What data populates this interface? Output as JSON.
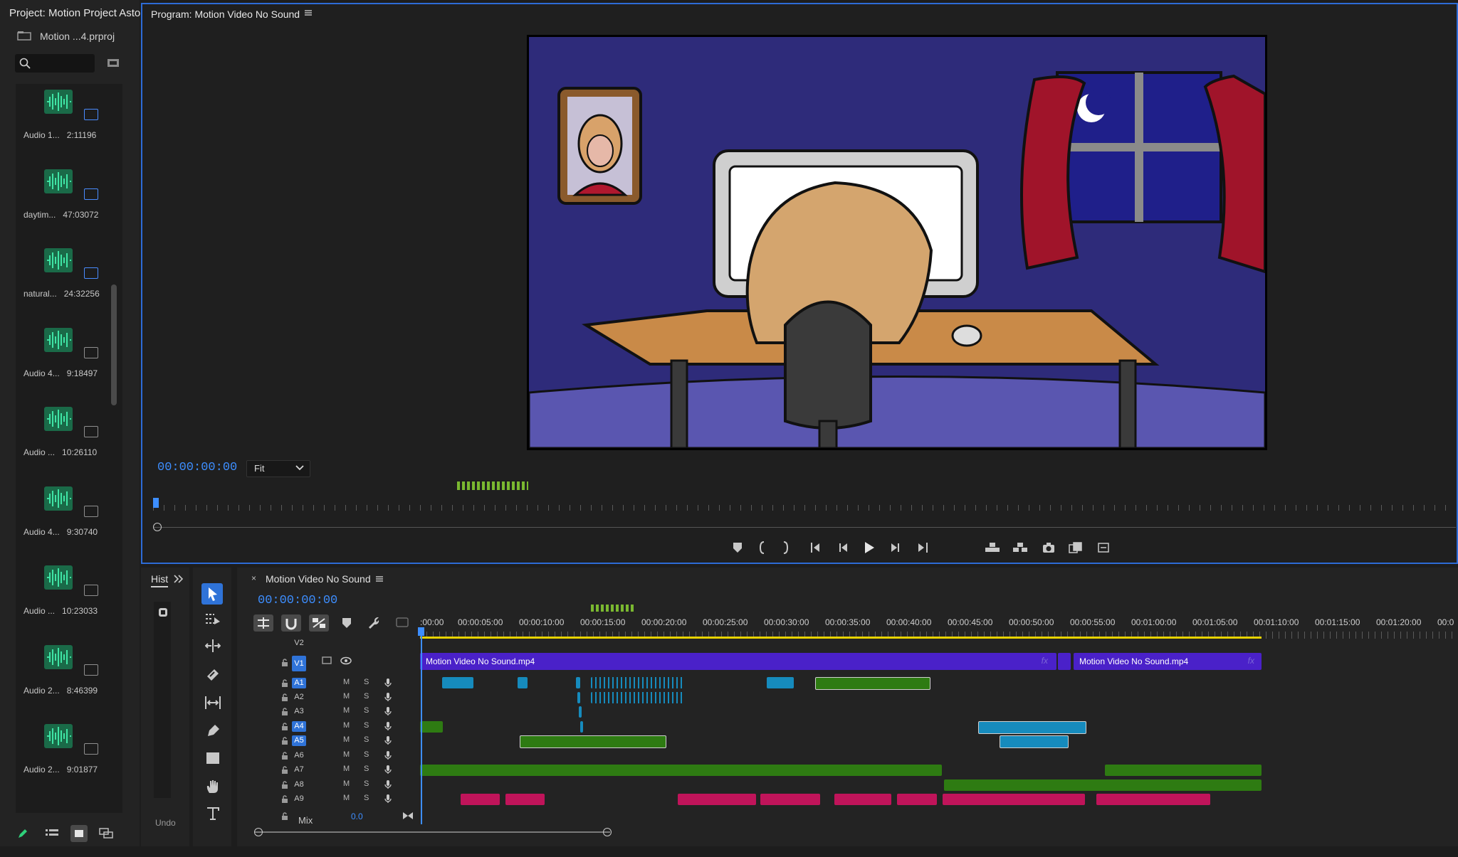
{
  "project": {
    "title": "Project: Motion Project Aston",
    "file": "Motion ...4.prproj",
    "clips": [
      {
        "name": "Audio 1...",
        "duration": "2:11196"
      },
      {
        "name": "daytim...",
        "duration": "47:03072"
      },
      {
        "name": "natural...",
        "duration": "24:32256"
      },
      {
        "name": "Audio 4...",
        "duration": "9:18497"
      },
      {
        "name": "Audio ...",
        "duration": "10:26110"
      },
      {
        "name": "Audio 4...",
        "duration": "9:30740"
      },
      {
        "name": "Audio ...",
        "duration": "10:23033"
      },
      {
        "name": "Audio 2...",
        "duration": "8:46399"
      },
      {
        "name": "Audio 2...",
        "duration": "9:01877"
      }
    ]
  },
  "program": {
    "title": "Program: Motion Video No Sound",
    "timecode": "00:00:00:00",
    "fit": "Fit"
  },
  "history": {
    "title": "Hist",
    "undo": "Undo"
  },
  "timeline": {
    "title": "Motion Video No Sound",
    "timecode": "00:00:00:00",
    "ruler": [
      ":00:00",
      "00:00:05:00",
      "00:00:10:00",
      "00:00:15:00",
      "00:00:20:00",
      "00:00:25:00",
      "00:00:30:00",
      "00:00:35:00",
      "00:00:40:00",
      "00:00:45:00",
      "00:00:50:00",
      "00:00:55:00",
      "00:01:00:00",
      "00:01:05:00",
      "00:01:10:00",
      "00:01:15:00",
      "00:01:20:00",
      "00:0"
    ],
    "tracks": {
      "v2": "V2",
      "v1": "V1",
      "audio": [
        "A1",
        "A2",
        "A3",
        "A4",
        "A5",
        "A6",
        "A7",
        "A8",
        "A9"
      ],
      "mute": "M",
      "solo": "S",
      "mix": "Mix",
      "mix_value": "0.0"
    },
    "video_clips": [
      "Motion Video No Sound.mp4",
      "Motion Video No Sound.mp4"
    ],
    "fx": "fx"
  }
}
